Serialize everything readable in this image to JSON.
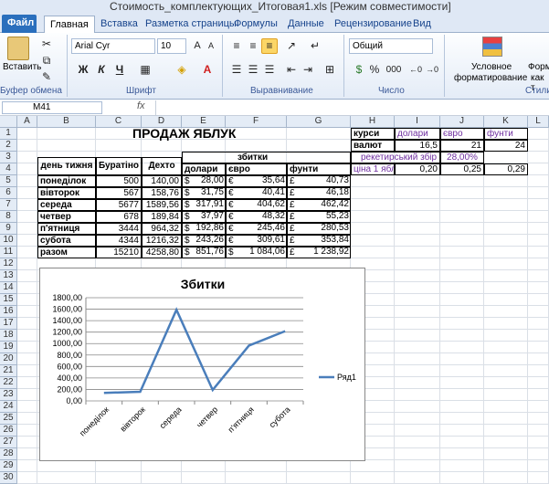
{
  "window": {
    "title": "Стоимость_комплектующих_Итоговая1.xls  [Режим совместимости]"
  },
  "tabs": [
    "Файл",
    "Главная",
    "Вставка",
    "Разметка страницы",
    "Формулы",
    "Данные",
    "Рецензирование",
    "Вид"
  ],
  "ribbon": {
    "paste_label": "Вставить",
    "clipboard_label": "Буфер обмена",
    "font_name": "Arial Cyr",
    "font_size": "10",
    "font_label": "Шрифт",
    "align_label": "Выравнивание",
    "number_format": "Общий",
    "number_label": "Число",
    "cond_format_label1": "Условное",
    "cond_format_label2": "форматирование",
    "format_label1": "Форм",
    "format_label2": "как т",
    "styles_label": "Стили",
    "bold": "Ж",
    "italic": "К",
    "underline": "Ч",
    "percent": "%",
    "thousands": "000"
  },
  "formula_bar": {
    "name_box": "M41",
    "fx": "fx",
    "value": ""
  },
  "columns": [
    "A",
    "B",
    "C",
    "D",
    "E",
    "F",
    "G",
    "H",
    "I",
    "J",
    "K",
    "L"
  ],
  "rows": [
    "1",
    "2",
    "3",
    "4",
    "5",
    "6",
    "7",
    "8",
    "9",
    "10",
    "11",
    "12",
    "13",
    "14",
    "15",
    "16",
    "17",
    "18",
    "19",
    "20",
    "21",
    "22",
    "23",
    "24",
    "25",
    "26",
    "27",
    "28",
    "29",
    "30"
  ],
  "sheet": {
    "title": "ПРОДАЖ ЯБЛУК",
    "headers": {
      "day": "день тижня",
      "buratino": "Буратіно",
      "dekhto": "Дехто",
      "zbytky": "збитки",
      "dolary": "долари",
      "euro": "євро",
      "funty": "фунти"
    },
    "table": [
      {
        "day": "понеділок",
        "b": "500",
        "d": "140,00",
        "e_sym": "$",
        "e": "28,00",
        "f_sym": "€",
        "f": "35,64",
        "g_sym": "£",
        "g": "40,73"
      },
      {
        "day": "вівторок",
        "b": "567",
        "d": "158,76",
        "e_sym": "$",
        "e": "31,75",
        "f_sym": "€",
        "f": "40,41",
        "g_sym": "£",
        "g": "46,18"
      },
      {
        "day": "середа",
        "b": "5677",
        "d": "1589,56",
        "e_sym": "$",
        "e": "317,91",
        "f_sym": "€",
        "f": "404,62",
        "g_sym": "£",
        "g": "462,42"
      },
      {
        "day": "четвер",
        "b": "678",
        "d": "189,84",
        "e_sym": "$",
        "e": "37,97",
        "f_sym": "€",
        "f": "48,32",
        "g_sym": "£",
        "g": "55,23"
      },
      {
        "day": "п'ятниця",
        "b": "3444",
        "d": "964,32",
        "e_sym": "$",
        "e": "192,86",
        "f_sym": "€",
        "f": "245,46",
        "g_sym": "£",
        "g": "280,53"
      },
      {
        "day": "субота",
        "b": "4344",
        "d": "1216,32",
        "e_sym": "$",
        "e": "243,26",
        "f_sym": "€",
        "f": "309,61",
        "g_sym": "£",
        "g": "353,84"
      },
      {
        "day": "разом",
        "b": "15210",
        "d": "4258,80",
        "e_sym": "$",
        "e": "851,76",
        "f_sym": "$",
        "f": "1 084,06",
        "g_sym": "£",
        "g": "1 238,92"
      }
    ],
    "side": {
      "kursy": "курси",
      "valiut": "валют",
      "dolary": "долари",
      "euro": "євро",
      "funty": "фунти",
      "rate_usd": "16,5",
      "rate_eur": "21",
      "rate_gbp": "24",
      "racket": "рекетирський збір",
      "racket_val": "28,00%",
      "price": "ціна 1 ябл",
      "price_usd": "0,20",
      "price_eur": "0,25",
      "price_gbp": "0,29"
    }
  },
  "chart_data": {
    "type": "line",
    "title": "Збитки",
    "categories": [
      "понеділок",
      "вівторок",
      "середа",
      "четвер",
      "п'ятниця",
      "субота"
    ],
    "series": [
      {
        "name": "Ряд1",
        "values": [
          140,
          158.76,
          1589.56,
          189.84,
          964.32,
          1216.32
        ],
        "color": "#4a7ebb"
      }
    ],
    "yticks": [
      "0,00",
      "200,00",
      "400,00",
      "600,00",
      "800,00",
      "1000,00",
      "1200,00",
      "1400,00",
      "1600,00",
      "1800,00"
    ],
    "ylim": [
      0,
      1800
    ],
    "grid": true,
    "legend": "right"
  }
}
